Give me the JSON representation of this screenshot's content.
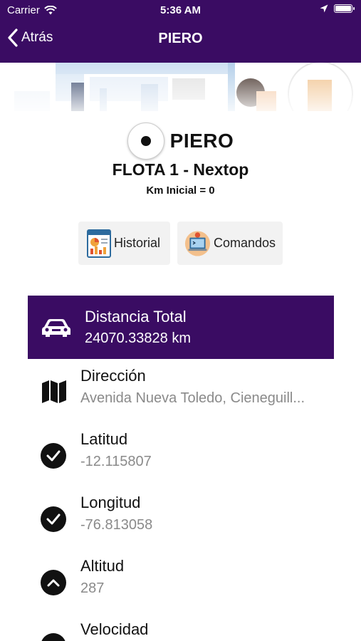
{
  "status": {
    "carrier": "Carrier",
    "time": "5:36 AM"
  },
  "nav": {
    "back_label": "Atrás",
    "title": "PIERO"
  },
  "device": {
    "name": "PIERO",
    "fleet": "FLOTA 1 - Nextop",
    "km_initial": "Km Inicial = 0"
  },
  "actions": [
    {
      "label": "Historial",
      "icon": "report-icon"
    },
    {
      "label": "Comandos",
      "icon": "terminal-icon"
    }
  ],
  "distance": {
    "label": "Distancia Total",
    "value": "24070.33828 km",
    "icon": "car-icon"
  },
  "fields": [
    {
      "label": "Dirección",
      "value": "Avenida Nueva Toledo, Cieneguill...",
      "icon": "map-icon"
    },
    {
      "label": "Latitud",
      "value": "-12.115807",
      "icon": "check-circle-icon"
    },
    {
      "label": "Longitud",
      "value": "-76.813058",
      "icon": "check-circle-icon"
    },
    {
      "label": "Altitud",
      "value": "287",
      "icon": "chevron-up-circle-icon"
    },
    {
      "label": "Velocidad",
      "value": "",
      "icon": "speedometer-icon"
    }
  ],
  "colors": {
    "primary": "#3a0c63",
    "button_bg": "#f2f2f2",
    "value_gray": "#8a8a8a"
  }
}
